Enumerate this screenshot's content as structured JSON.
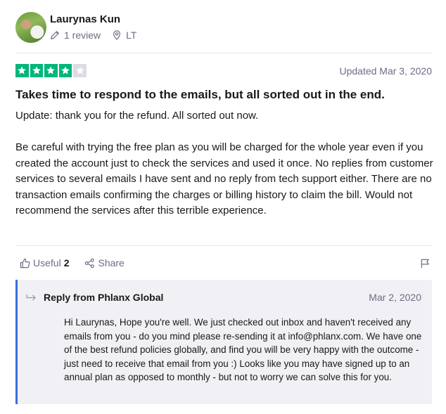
{
  "reviewer": {
    "name": "Laurynas Kun",
    "reviews": "1 review",
    "country": "LT"
  },
  "review": {
    "rating": 4,
    "max_rating": 5,
    "date": "Updated Mar 3, 2020",
    "title": "Takes time to respond to the emails, but all sorted out in the end.",
    "paragraphs": [
      "Update: thank you for the refund. All sorted out now.",
      "Be careful with trying the free plan as you will be charged for the whole year even if you created the account just to check the services and used it once. No replies from customer services to several emails I have sent and no reply from tech support either. There are no transaction emails confirming the charges or billing history to claim the bill. Would not recommend the services after this terrible experience."
    ]
  },
  "actions": {
    "useful_label": "Useful",
    "useful_count": "2",
    "share_label": "Share"
  },
  "reply": {
    "from": "Reply from Phlanx Global",
    "date": "Mar 2, 2020",
    "text": "Hi Laurynas, Hope you're well. We just checked out inbox and haven't received any emails from you - do you mind please re-sending it at info@phlanx.com. We have one of the best refund policies globally, and find you will be very happy with the outcome - just need to receive that email from you :) Looks like you may have signed up to an annual plan as opposed to monthly - but not to worry we can solve this for you."
  },
  "colors": {
    "star_on": "#00b67a",
    "star_off": "#dcdce6",
    "reply_accent": "#3b6dde"
  },
  "icons": [
    "pencil-icon",
    "location-pin-icon",
    "star-icon",
    "thumbs-up-icon",
    "share-icon",
    "flag-icon",
    "reply-arrow-icon"
  ]
}
